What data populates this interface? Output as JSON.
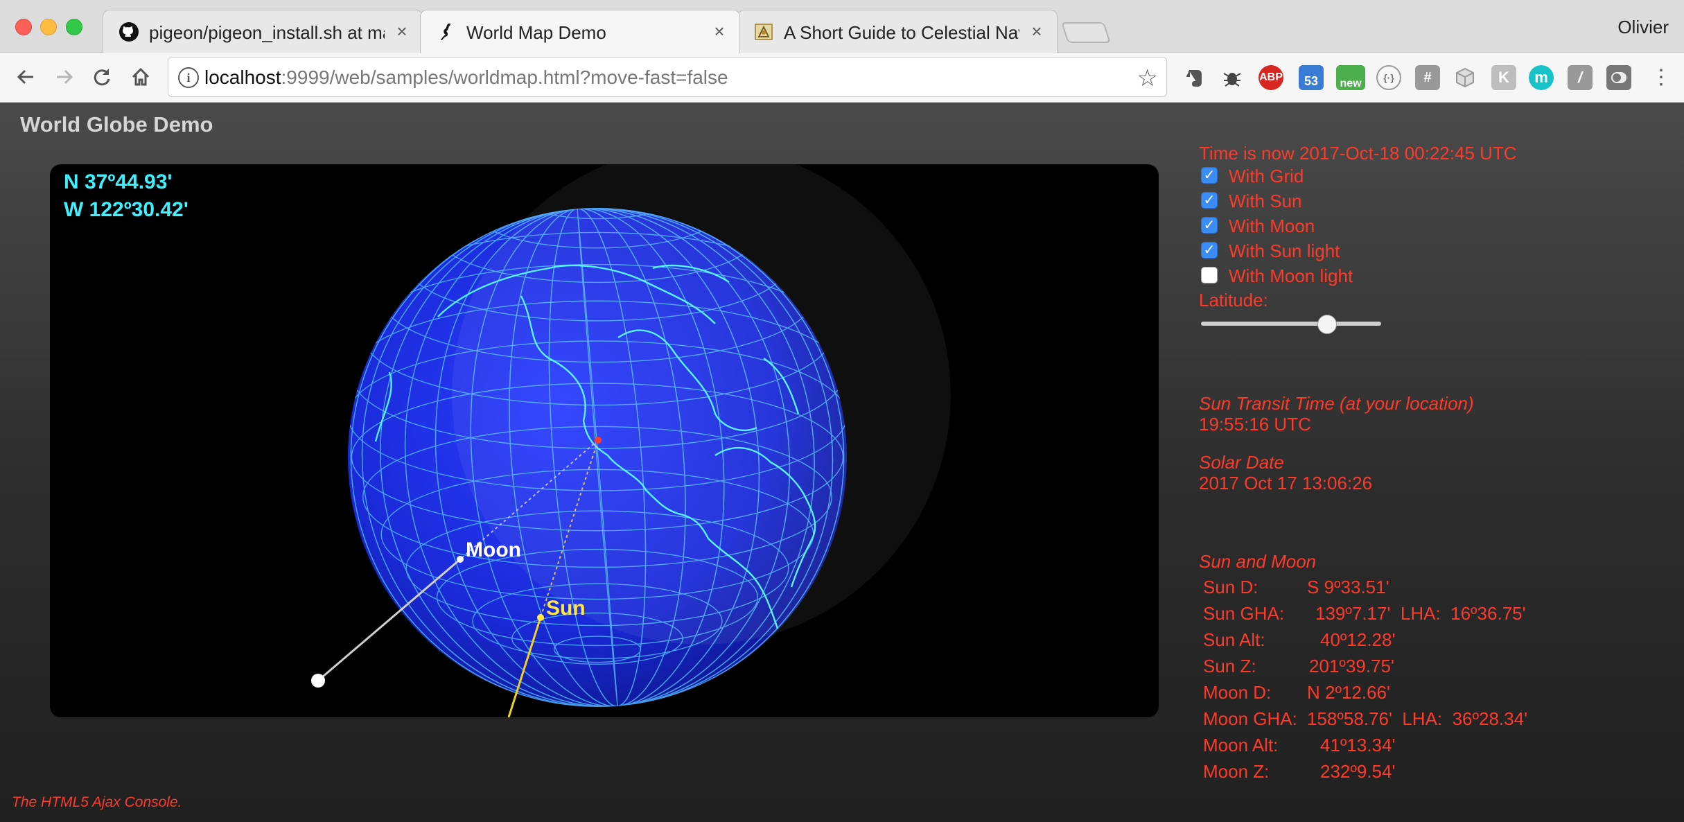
{
  "browser": {
    "tabs": [
      {
        "title": "pigeon/pigeon_install.sh at ma",
        "icon": "github-icon",
        "active": false
      },
      {
        "title": "World Map Demo",
        "icon": "lizard-icon",
        "active": true
      },
      {
        "title": "A Short Guide to Celestial Navi",
        "icon": "sextant-icon",
        "active": false
      }
    ],
    "profile_name": "Olivier",
    "url_host": "localhost",
    "url_rest": ":9999/web/samples/worldmap.html?move-fast=false",
    "extensions": [
      {
        "name": "evernote-icon",
        "text": ""
      },
      {
        "name": "bug-icon",
        "text": ""
      },
      {
        "name": "adblock-icon",
        "text": "ABP"
      },
      {
        "name": "weather-icon",
        "text": "53"
      },
      {
        "name": "new-extension-icon",
        "text": "new"
      },
      {
        "name": "json-viewer-icon",
        "text": "{·}"
      },
      {
        "name": "hash-icon",
        "text": "#"
      },
      {
        "name": "cube-icon",
        "text": ""
      },
      {
        "name": "k-icon",
        "text": "K"
      },
      {
        "name": "m-icon",
        "text": "m"
      },
      {
        "name": "slash-icon",
        "text": "/"
      },
      {
        "name": "toggle-icon",
        "text": ""
      }
    ]
  },
  "page": {
    "title": "World Globe Demo",
    "position": {
      "lat": "N 37º44.93'",
      "lng": "W 122º30.42'"
    },
    "globe_labels": {
      "moon": "Moon",
      "sun": "Sun"
    },
    "time_now": "Time is now 2017-Oct-18 00:22:45 UTC",
    "options": [
      {
        "label": "With Grid",
        "checked": true
      },
      {
        "label": "With Sun",
        "checked": true
      },
      {
        "label": "With Moon",
        "checked": true
      },
      {
        "label": "With Sun light",
        "checked": true
      },
      {
        "label": "With Moon light",
        "checked": false
      }
    ],
    "latitude_label": "Latitude:",
    "latitude_slider_fraction": 0.7,
    "transit_heading": "Sun Transit Time (at your location)",
    "transit_value": "19:55:16 UTC",
    "solar_date_heading": "Solar Date",
    "solar_date_value": "2017 Oct 17 13:06:26",
    "sun_moon_heading": "Sun and Moon",
    "rows": [
      {
        "key": "Sun D:",
        "value": "S 9º33.51'"
      },
      {
        "key": "Sun GHA:",
        "value": "139º7.17'  LHA:  16º36.75'"
      },
      {
        "key": "Sun Alt:",
        "value": "40º12.28'"
      },
      {
        "key": "Sun Z:",
        "value": "201º39.75'"
      },
      {
        "key": "Moon D:",
        "value": "N 2º12.66'"
      },
      {
        "key": "Moon GHA:",
        "value": "158º58.76'  LHA:  36º28.34'"
      },
      {
        "key": "Moon Alt:",
        "value": "41º13.34'"
      },
      {
        "key": "Moon Z:",
        "value": "232º9.54'"
      }
    ],
    "console_note": "The HTML5 Ajax Console."
  },
  "colors": {
    "accent_red": "#ff3a2a",
    "coords_cyan": "#3ff0ff",
    "globe_blue": "#1c2ee0",
    "grid": "#58c8ff"
  }
}
